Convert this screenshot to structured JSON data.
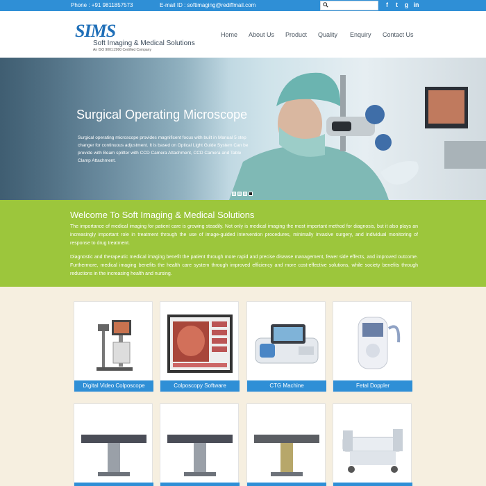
{
  "topbar": {
    "phone": "Phone : +91 9811857573",
    "email": "E-mail ID : softimaging@rediffmail.com",
    "search_placeholder": "",
    "social": [
      "f",
      "t",
      "g",
      "in"
    ]
  },
  "header": {
    "logo_mark": "SIMS",
    "logo_name": "Soft Imaging & Medical Solutions",
    "logo_sub": "An ISO 9001:2000 Certified Company",
    "nav": [
      "Home",
      "About Us",
      "Product",
      "Quality",
      "Enquiry",
      "Contact Us"
    ]
  },
  "hero": {
    "title": "Surgical Operating Microscope",
    "text": "Surgical operating microscope provides magnificent focus with built in Manual 5 step changer for continuous adjustment. It is based on Optical Light Guide System Can be provide with Beam splitter with CCD Camera Attachment, CCD Camera and Table Clamp Attachment.",
    "slides": 4,
    "active_slide": 4
  },
  "welcome": {
    "title": "Welcome To Soft Imaging & Medical Solutions",
    "p1": "The importance of medical imaging for patient care is growing steadily. Not only is medical imaging the most important method for diagnosis, but it also plays an increasingly important role in treatment through the use of image-guided intervention procedures, minimally invasive surgery, and individual monitoring of response to drug treatment.",
    "p2": "Diagnostic and therapeutic medical imaging benefit the patient through more rapid and precise disease management, fewer side effects, and improved outcome. Furthermore, medical imaging benefits the health care system through improved efficiency and more cost-effective solutions, while society benefits through reductions in the increasing health and nursing."
  },
  "products": [
    {
      "label": "Digital Video Colposcope"
    },
    {
      "label": "Colposcopy Software"
    },
    {
      "label": "CTG Machine"
    },
    {
      "label": "Fetal Doppler"
    },
    {
      "label": ""
    },
    {
      "label": ""
    },
    {
      "label": ""
    },
    {
      "label": ""
    }
  ],
  "colors": {
    "accent_blue": "#2f8fd6",
    "welcome_green": "#9cc63c",
    "page_bg": "#f6efe0"
  }
}
